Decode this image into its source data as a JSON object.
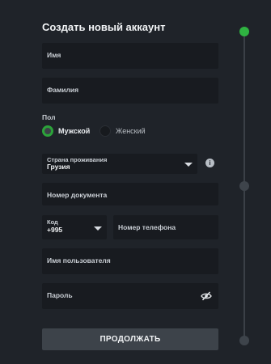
{
  "form": {
    "title": "Создать новый аккаунт",
    "first_name_placeholder": "Имя",
    "last_name_placeholder": "Фамилия",
    "gender": {
      "label": "Пол",
      "options": [
        "Мужской",
        "Женский"
      ],
      "selected": "Мужской"
    },
    "country": {
      "label": "Страна проживания",
      "value": "Грузия"
    },
    "document_placeholder": "Номер документа",
    "phone_code": {
      "label": "Код",
      "value": "+995"
    },
    "phone_placeholder": "Номер телефона",
    "username_placeholder": "Имя пользователя",
    "password_placeholder": "Пароль",
    "continue_label": "ПРОДОЛЖАТЬ"
  },
  "progress": {
    "steps": 3,
    "active_step": 1,
    "active_color": "#2fb341",
    "inactive_color": "#3e444b"
  },
  "icons": {
    "info": "info-icon",
    "password_toggle": "eye-slash-icon",
    "dropdown": "chevron-down-icon"
  }
}
